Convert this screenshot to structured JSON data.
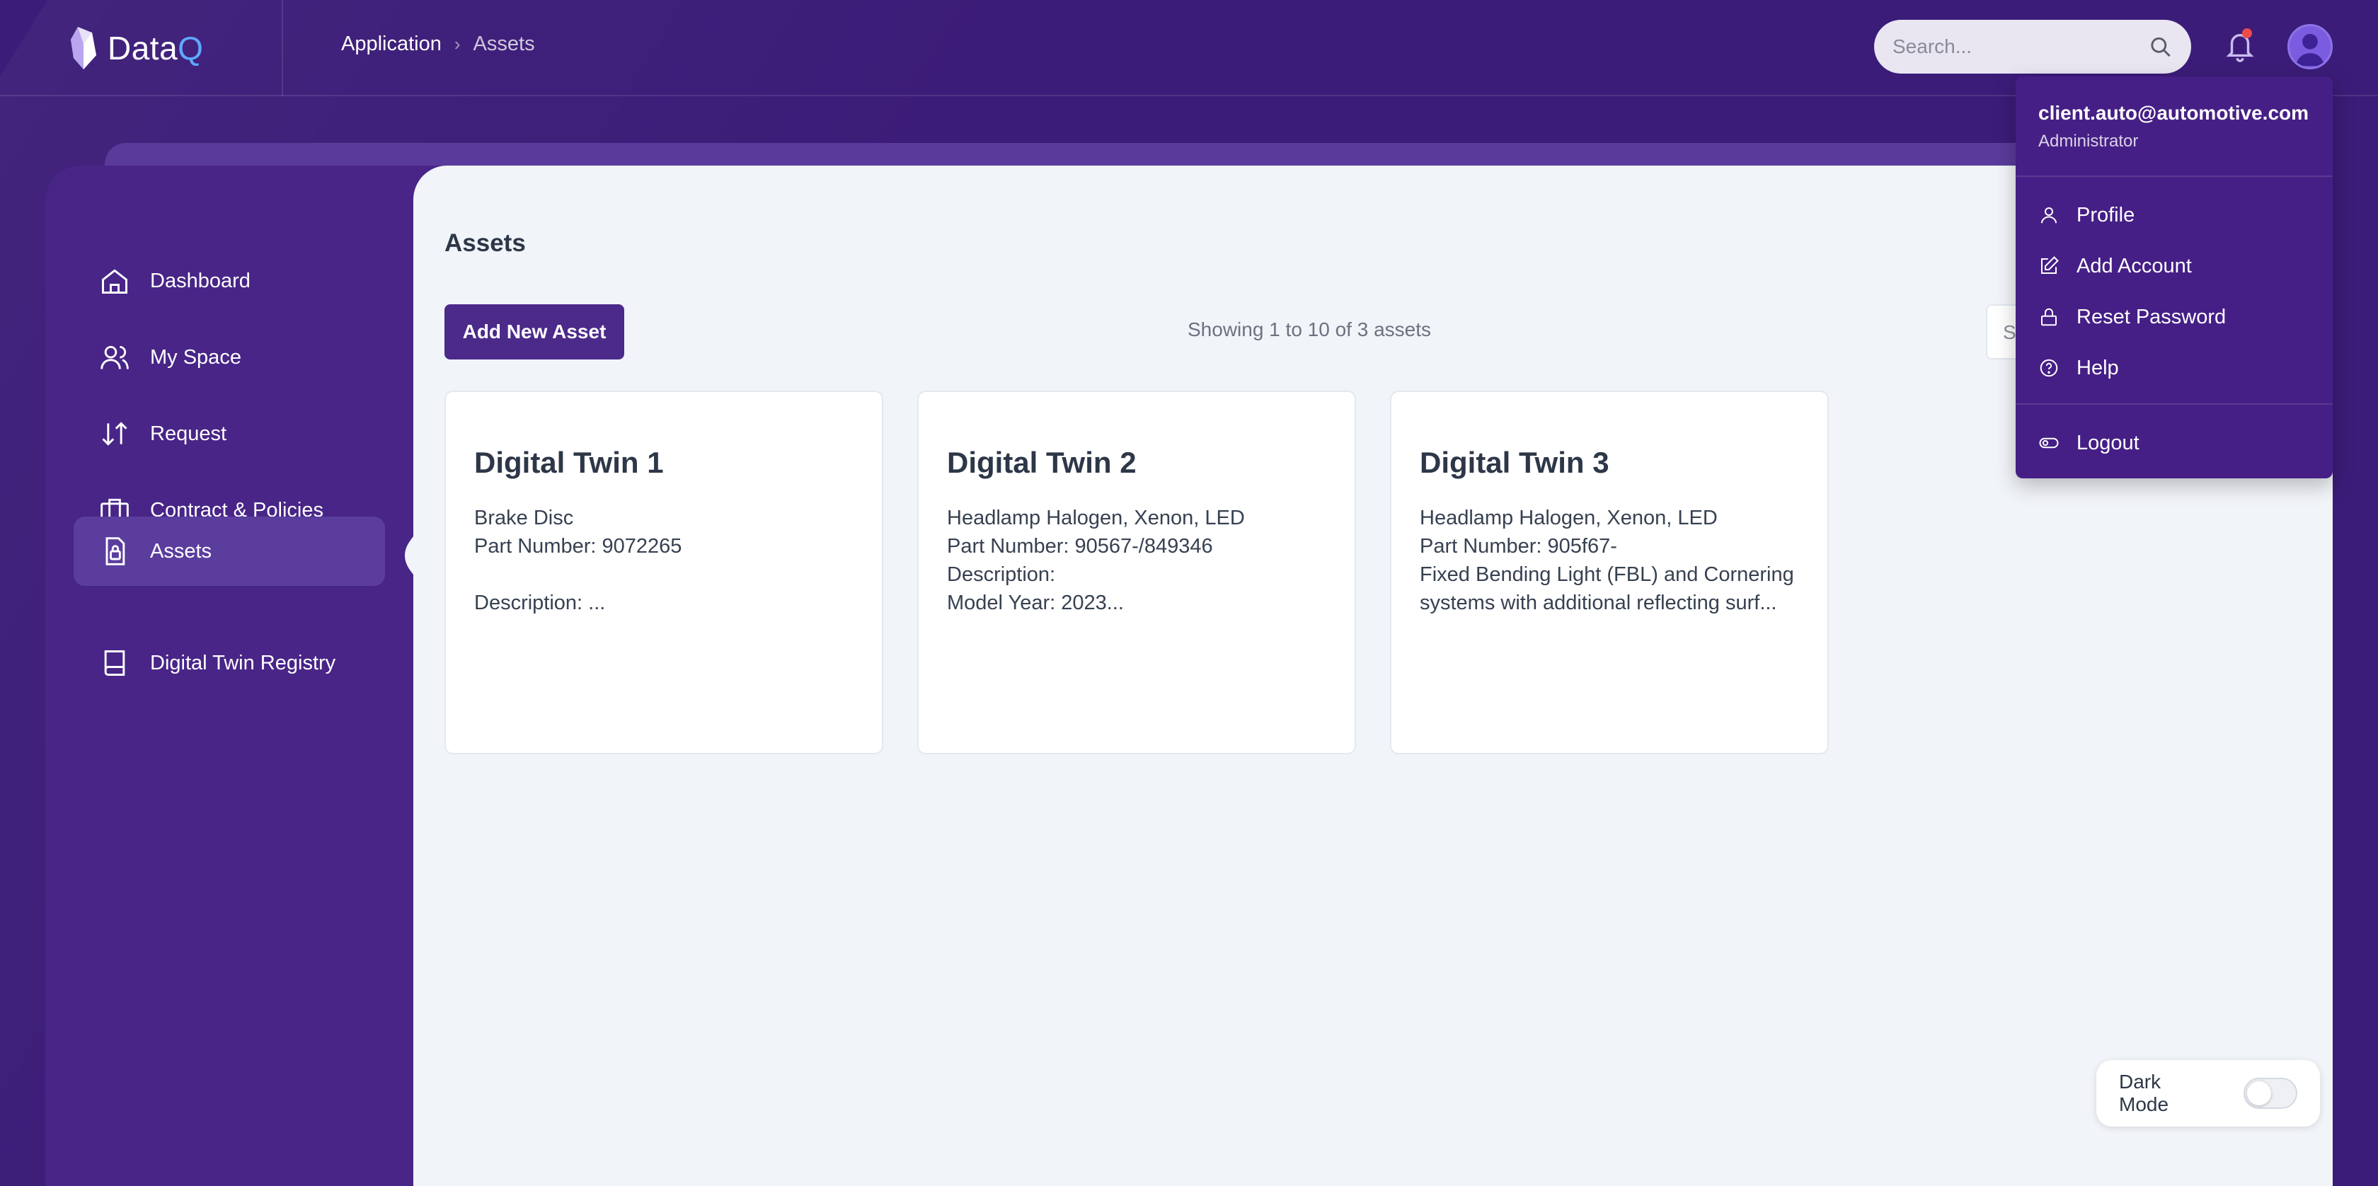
{
  "brand": {
    "name_main": "Data",
    "name_accent": "Q"
  },
  "breadcrumb": {
    "parent": "Application",
    "separator": "›",
    "current": "Assets"
  },
  "top_search": {
    "placeholder": "Search..."
  },
  "sidebar": {
    "items": [
      {
        "label": "Dashboard",
        "icon": "home-icon"
      },
      {
        "label": "My Space",
        "icon": "users-icon"
      },
      {
        "label": "Request",
        "icon": "arrows-updown-icon"
      },
      {
        "label": "Contract & Policies",
        "icon": "briefcase-icon"
      },
      {
        "label": "Assets",
        "icon": "lock-doc-icon",
        "active": true
      },
      {
        "label": "Digital Twin Registry",
        "icon": "book-icon"
      }
    ]
  },
  "main": {
    "title": "Assets",
    "add_button": "Add New Asset",
    "showing": "Showing 1 to 10 of 3 assets",
    "search_placeholder": "S",
    "cards": [
      {
        "title": "Digital Twin 1",
        "lines": [
          "Brake Disc",
          "Part Number: 9072265",
          "",
          "Description: ..."
        ]
      },
      {
        "title": "Digital Twin 2",
        "lines": [
          "Headlamp Halogen, Xenon, LED",
          "Part Number: 90567-/849346",
          "Description:",
          "Model Year: 2023..."
        ]
      },
      {
        "title": "Digital Twin 3",
        "lines": [
          "Headlamp Halogen, Xenon, LED",
          "Part Number: 905f67-",
          "Fixed Bending Light (FBL) and Cornering systems with additional reflecting surf..."
        ]
      }
    ]
  },
  "user_menu": {
    "email": "client.auto@automotive.com",
    "role": "Administrator",
    "items": [
      {
        "label": "Profile",
        "icon": "user-icon"
      },
      {
        "label": "Add Account",
        "icon": "edit-icon"
      },
      {
        "label": "Reset Password",
        "icon": "lock-icon"
      },
      {
        "label": "Help",
        "icon": "help-circle-icon"
      }
    ],
    "logout": {
      "label": "Logout",
      "icon": "toggle-icon"
    }
  },
  "dark_mode": {
    "label": "Dark Mode",
    "enabled": false
  },
  "colors": {
    "bg": "#3b1c78",
    "sidebar": "#482587",
    "accent": "#4b2a8a",
    "menu": "#451f86",
    "logo_accent": "#5fa8ff",
    "notification": "#ef4a4a"
  }
}
